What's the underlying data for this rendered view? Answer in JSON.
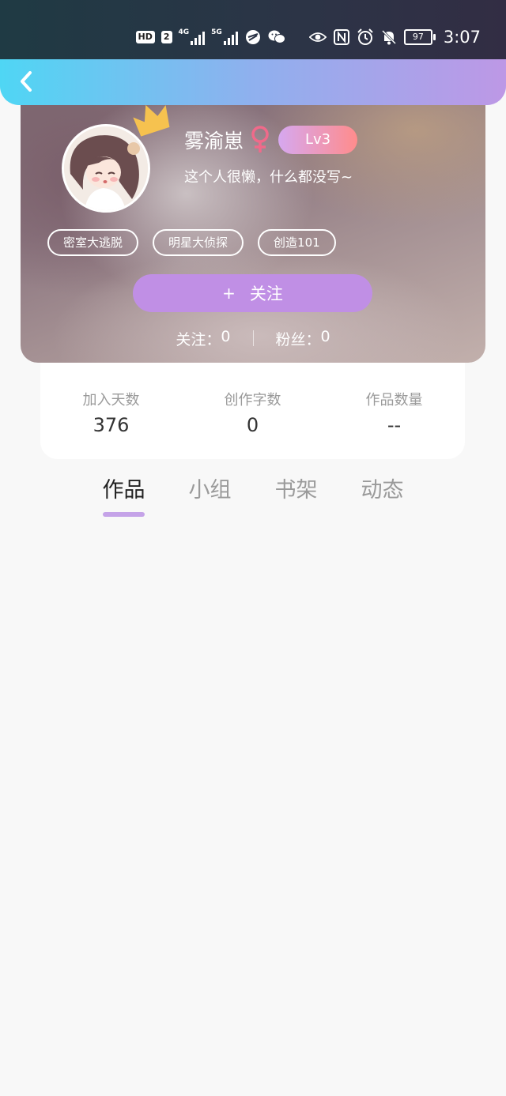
{
  "status_bar": {
    "hd_label": "HD",
    "sim_label": "2",
    "net1_label": "4G",
    "net2_label": "5G",
    "battery": "97",
    "time": "3:07",
    "icons": [
      "hd-icon",
      "signal-icon",
      "vpn-icon",
      "wechat-icon",
      "eye-icon",
      "nfc-icon",
      "alarm-icon",
      "mute-icon",
      "battery-icon"
    ]
  },
  "nav": {
    "back_icon": "chevron-left-icon"
  },
  "profile": {
    "name": "雾渝崽",
    "gender_icon": "female-icon",
    "level": "Lv3",
    "bio": "这个人很懒，什么都没写~",
    "tags": [
      "密室大逃脱",
      "明星大侦探",
      "创造101"
    ],
    "follow_plus": "+",
    "follow_label": "关注",
    "following_label": "关注：",
    "following_count": "0",
    "fans_label": "粉丝：",
    "fans_count": "0"
  },
  "stats": [
    {
      "label": "加入天数",
      "value": "376"
    },
    {
      "label": "创作字数",
      "value": "0"
    },
    {
      "label": "作品数量",
      "value": "--"
    }
  ],
  "tabs": [
    "作品",
    "小组",
    "书架",
    "动态"
  ],
  "active_tab": "作品",
  "colors": {
    "nav_gradient_start": "#4fd6f4",
    "nav_gradient_end": "#bd98e6",
    "follow_button": "#c08fe5",
    "level_start": "#d6a8f0",
    "level_end": "#ff8c8c",
    "tab_indicator": "#c5a3e8"
  }
}
